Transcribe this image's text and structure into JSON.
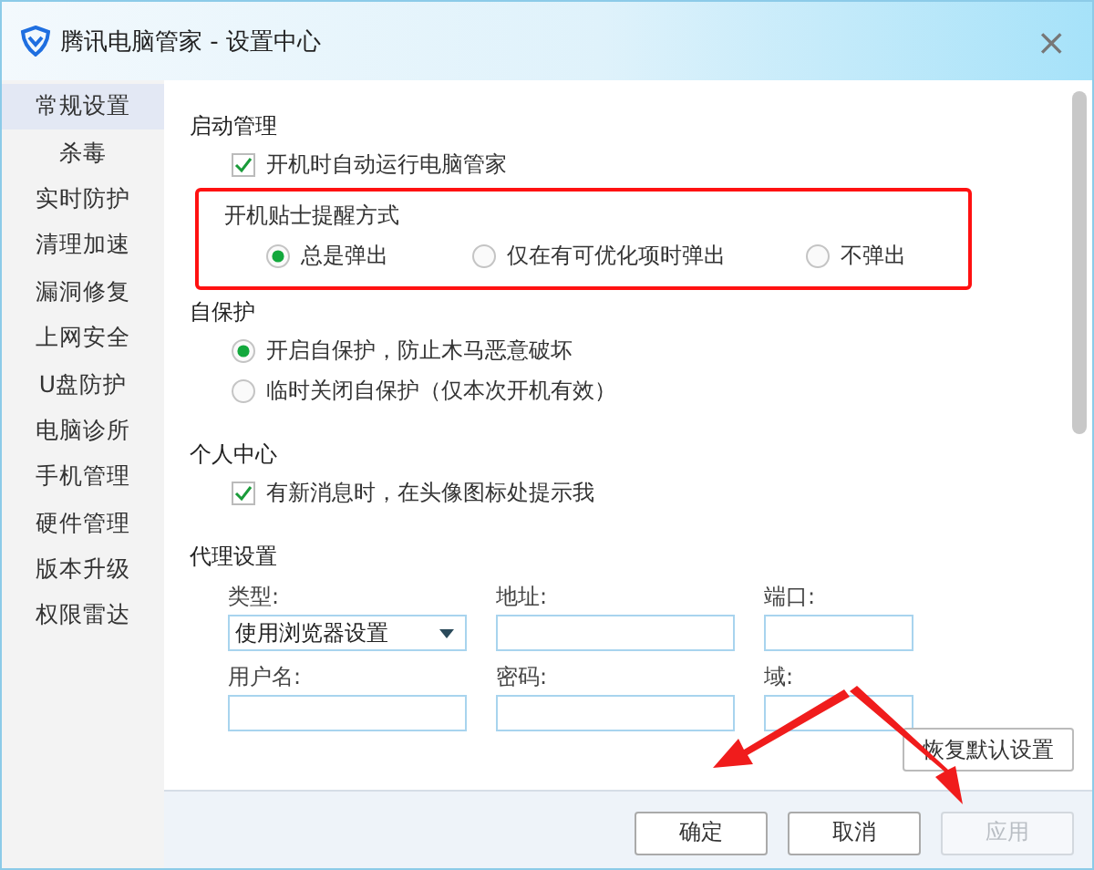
{
  "window": {
    "title": "腾讯电脑管家 - 设置中心",
    "close": "×"
  },
  "sidebar": {
    "items": [
      {
        "label": "常规设置",
        "selected": true
      },
      {
        "label": "杀毒",
        "selected": false
      },
      {
        "label": "实时防护",
        "selected": false
      },
      {
        "label": "清理加速",
        "selected": false
      },
      {
        "label": "漏洞修复",
        "selected": false
      },
      {
        "label": "上网安全",
        "selected": false
      },
      {
        "label": "U盘防护",
        "selected": false
      },
      {
        "label": "电脑诊所",
        "selected": false
      },
      {
        "label": "手机管理",
        "selected": false
      },
      {
        "label": "硬件管理",
        "selected": false
      },
      {
        "label": "版本升级",
        "selected": false
      },
      {
        "label": "权限雷达",
        "selected": false
      }
    ]
  },
  "sections": [
    {
      "title": "启动管理",
      "items": [
        {
          "kind": "checkbox",
          "label": "开机时自动运行电脑管家",
          "checked": true
        },
        {
          "kind": "radio-group",
          "title": "开机贴士提醒方式",
          "options": [
            {
              "label": "总是弹出",
              "selected": true
            },
            {
              "label": "仅在有可优化项时弹出",
              "selected": false
            },
            {
              "label": "不弹出",
              "selected": false
            }
          ]
        }
      ]
    },
    {
      "title": "自保护",
      "items": [
        {
          "kind": "radio",
          "label": "开启自保护，防止木马恶意破坏",
          "selected": true
        },
        {
          "kind": "radio",
          "label": "临时关闭自保护（仅本次开机有效）",
          "selected": false
        }
      ]
    },
    {
      "title": "个人中心",
      "items": [
        {
          "kind": "checkbox",
          "label": "有新消息时，在头像图标处提示我",
          "checked": true
        }
      ]
    }
  ],
  "proxy": {
    "title": "代理设置",
    "fields": [
      {
        "kind": "select",
        "label": "类型:",
        "value": "使用浏览器设置"
      },
      {
        "kind": "text",
        "label": "地址:"
      },
      {
        "kind": "text",
        "label": "端口:"
      },
      {
        "kind": "text",
        "label": "用户名:"
      },
      {
        "kind": "text",
        "label": "密码:"
      },
      {
        "kind": "text",
        "label": "域:"
      }
    ]
  },
  "restore_button": "恢复默认设置",
  "buttons": [
    {
      "label": "确定",
      "disabled": false
    },
    {
      "label": "取消",
      "disabled": false
    },
    {
      "label": "应用",
      "disabled": true
    }
  ]
}
